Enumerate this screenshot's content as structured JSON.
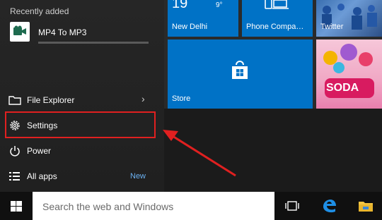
{
  "start_menu": {
    "recently_added": {
      "header": "Recently added",
      "app": {
        "name": "MP4 To MP3"
      }
    },
    "menu": [
      {
        "id": "file-explorer",
        "label": "File Explorer",
        "has_submenu": true
      },
      {
        "id": "settings",
        "label": "Settings",
        "highlighted": true
      },
      {
        "id": "power",
        "label": "Power"
      },
      {
        "id": "all-apps",
        "label": "All apps",
        "badge": "New"
      }
    ],
    "tiles": {
      "weather": {
        "temp": "19",
        "unit": "9°",
        "label": "New Delhi",
        "color": "#0072c6"
      },
      "phone": {
        "label": "Phone Compa…",
        "color": "#0072c6"
      },
      "twitter": {
        "label": "Twitter"
      },
      "store": {
        "label": "Store",
        "color": "#0072c6"
      },
      "candy": {
        "label": "SODA"
      }
    }
  },
  "taskbar": {
    "search_placeholder": "Search the web and Windows",
    "icons": [
      "windows-logo-icon",
      "task-view-icon",
      "edge-icon",
      "file-explorer-icon"
    ]
  },
  "annotation": {
    "color": "#e02020"
  }
}
